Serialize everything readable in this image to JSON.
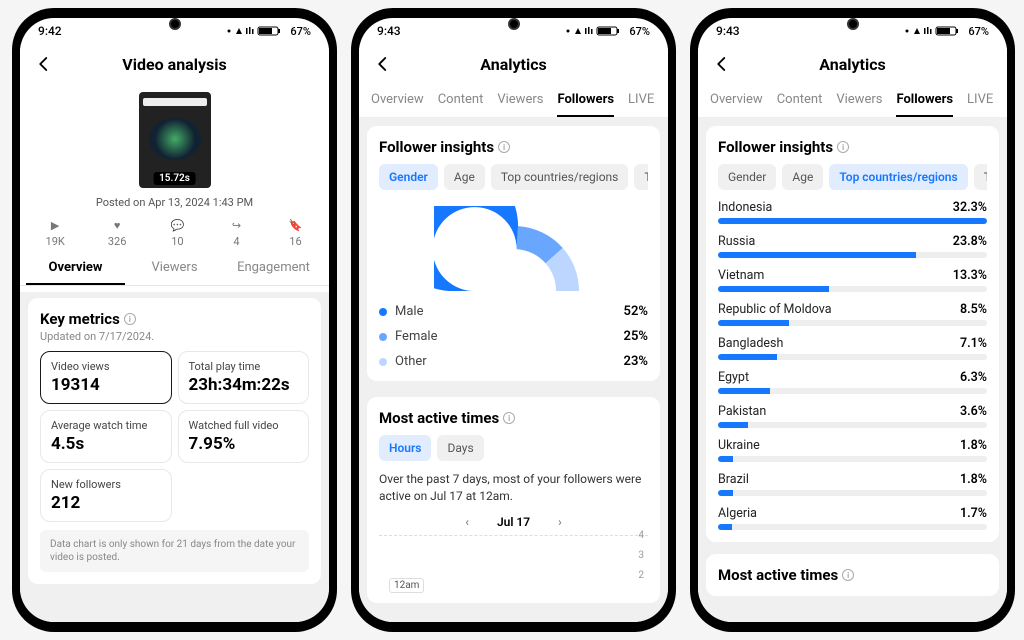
{
  "status": {
    "time1": "9:42",
    "time2": "9:43",
    "time3": "9:43",
    "battery": "67%"
  },
  "phone1": {
    "title": "Video analysis",
    "duration": "15.72s",
    "posted": "Posted on Apr 13, 2024 1:43 PM",
    "stats": {
      "plays": "19K",
      "likes": "326",
      "comments": "10",
      "shares": "4",
      "saves": "16"
    },
    "tabs": {
      "overview": "Overview",
      "viewers": "Viewers",
      "engagement": "Engagement"
    },
    "key_title": "Key metrics",
    "key_updated": "Updated on 7/17/2024.",
    "metrics": {
      "views_lbl": "Video views",
      "views_val": "19314",
      "play_lbl": "Total play time",
      "play_val": "23h:34m:22s",
      "avg_lbl": "Average watch time",
      "avg_val": "4.5s",
      "full_lbl": "Watched full video",
      "full_val": "7.95%",
      "newf_lbl": "New followers",
      "newf_val": "212"
    },
    "note": "Data chart is only shown for 21 days from the date your video is posted."
  },
  "analytics": {
    "title": "Analytics",
    "tabs": {
      "overview": "Overview",
      "content": "Content",
      "viewers": "Viewers",
      "followers": "Followers",
      "live": "LIVE"
    },
    "insights_title": "Follower insights",
    "pill_gender": "Gender",
    "pill_age": "Age",
    "pill_top": "Top countries/regions",
    "pill_topw": "Top",
    "active_title": "Most active times",
    "pill_hours": "Hours",
    "pill_days": "Days",
    "active_desc": "Over the past 7 days, most of your followers were active on Jul 17 at 12am.",
    "date": "Jul 17",
    "x12am": "12am"
  },
  "chart_data": {
    "type": "pie",
    "title": "Follower insights — Gender",
    "series": [
      {
        "name": "Male",
        "value": 52,
        "color": "#1677ff"
      },
      {
        "name": "Female",
        "value": 25,
        "color": "#69a7ff"
      },
      {
        "name": "Other",
        "value": 23,
        "color": "#bcd6ff"
      }
    ]
  },
  "countries": [
    {
      "name": "Indonesia",
      "pct": 32.3
    },
    {
      "name": "Russia",
      "pct": 23.8
    },
    {
      "name": "Vietnam",
      "pct": 13.3
    },
    {
      "name": "Republic of Moldova",
      "pct": 8.5
    },
    {
      "name": "Bangladesh",
      "pct": 7.1
    },
    {
      "name": "Egypt",
      "pct": 6.3
    },
    {
      "name": "Pakistan",
      "pct": 3.6
    },
    {
      "name": "Ukraine",
      "pct": 1.8
    },
    {
      "name": "Brazil",
      "pct": 1.8
    },
    {
      "name": "Algeria",
      "pct": 1.7
    }
  ]
}
